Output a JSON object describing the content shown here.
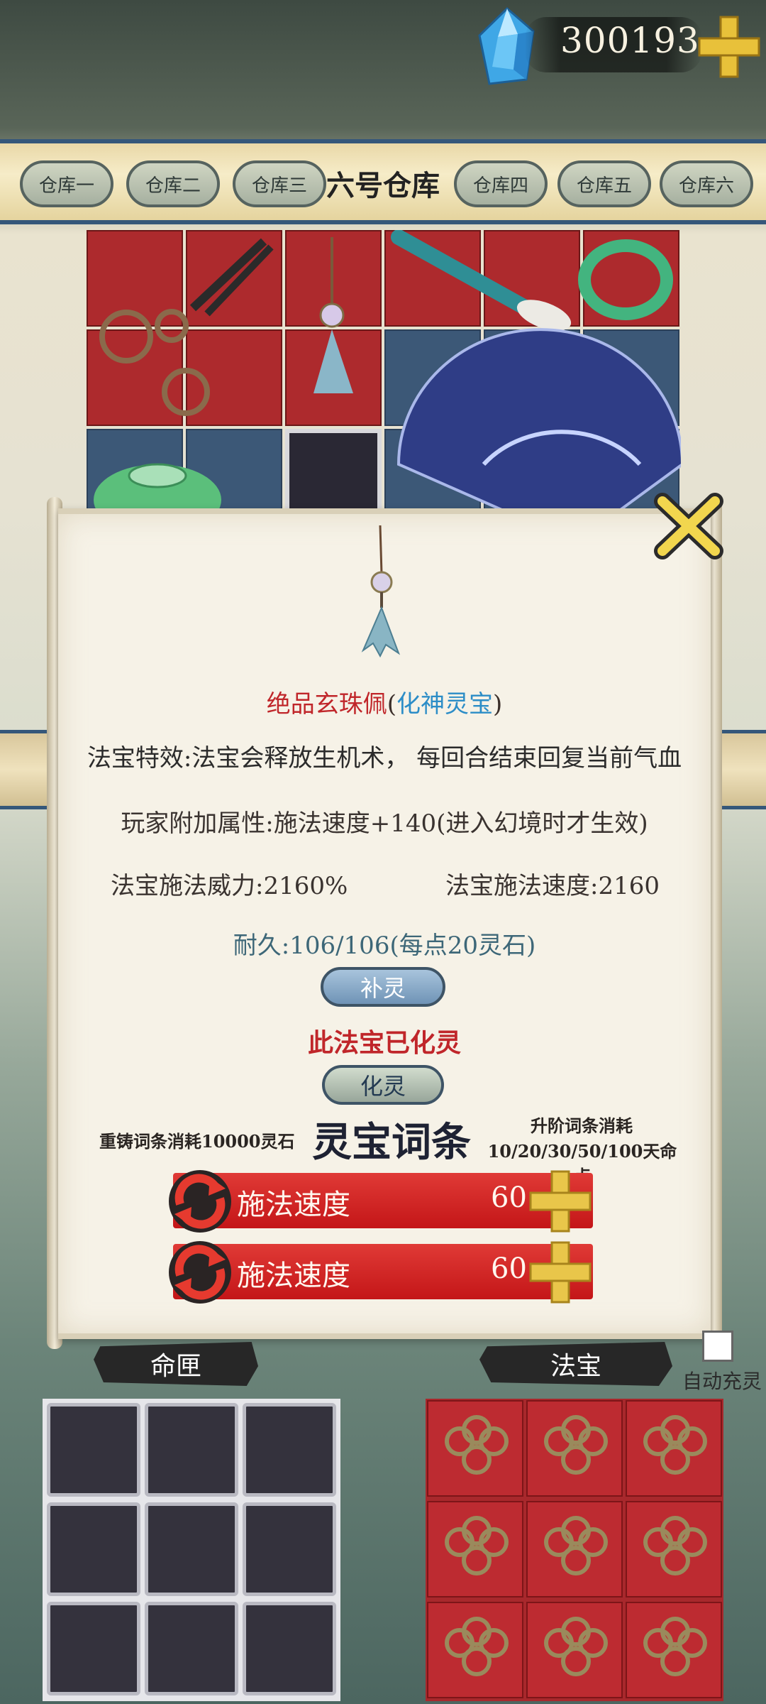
{
  "currency": {
    "amount": "300193"
  },
  "warehouse": {
    "tabs": [
      "仓库一",
      "仓库二",
      "仓库三",
      "仓库四",
      "仓库五",
      "仓库六"
    ],
    "active": "六号仓库"
  },
  "item": {
    "name": "绝品玄珠佩",
    "paren_open": "(",
    "type": "化神灵宝",
    "paren_close": ")",
    "effect": "法宝特效:法宝会释放生机术， 每回合结束回复当前气血",
    "bonus": "玩家附加属性:施法速度+140(进入幻境时才生效)",
    "power": "法宝施法威力:2160%",
    "speed": "法宝施法速度:2160",
    "durability": "耐久:106/106(每点20灵石)",
    "recharge_button": "补灵",
    "transformed_text": "此法宝已化灵",
    "transform_button": "化灵"
  },
  "affix_section": {
    "reforge_cost": "重铸词条消耗10000灵石",
    "title": "灵宝词条",
    "upgrade_cost_line1": "升阶词条消耗",
    "upgrade_cost_line2": "10/20/30/50/100天命点",
    "affixes": [
      {
        "name": "施法速度",
        "value": "60"
      },
      {
        "name": "施法速度",
        "value": "60"
      }
    ]
  },
  "bottom": {
    "left_title": "命匣",
    "right_title": "法宝",
    "auto_recharge": "自动充灵"
  },
  "colors": {
    "accent_red": "#c41618",
    "frame_blue": "#35577a",
    "gold": "#e8c13a"
  }
}
